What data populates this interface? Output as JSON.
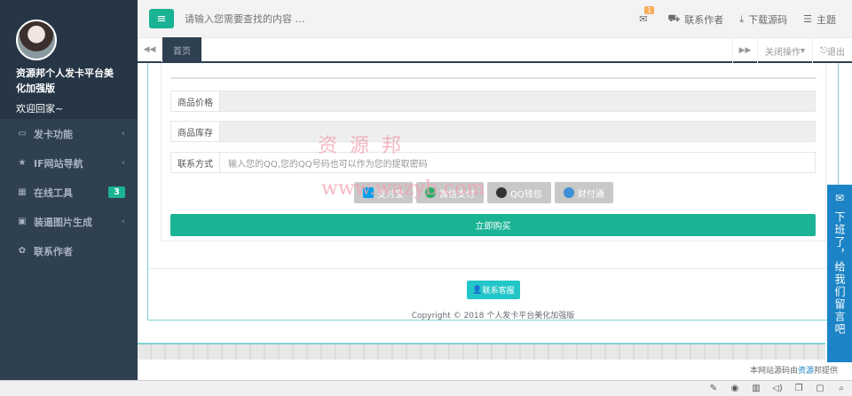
{
  "sidebar": {
    "user_name": "资源邦个人发卡平台美化加强版",
    "welcome": "欢迎回家~",
    "items": [
      {
        "label": "发卡功能",
        "icon": "monitor-icon"
      },
      {
        "label": "IF网站导航",
        "icon": "star-icon"
      },
      {
        "label": "在线工具",
        "icon": "grid-icon",
        "badge": "3"
      },
      {
        "label": "装逼图片生成",
        "icon": "image-icon"
      },
      {
        "label": "联系作者",
        "icon": "gear-icon"
      }
    ]
  },
  "topbar": {
    "search_placeholder": "请输入您需要查找的内容 …",
    "notification_count": "1",
    "contact_author": "联系作者",
    "download_source": "下载源码",
    "theme": "主题"
  },
  "tabs": {
    "home": "首页",
    "close_ops": "关闭操作",
    "logout": "退出"
  },
  "form": {
    "price_label": "商品价格",
    "stock_label": "商品库存",
    "contact_label": "联系方式",
    "contact_placeholder": "输入您的QQ,您的QQ号码也可以作为您的提取密码",
    "pay_alipay": "支付宝",
    "pay_wechat": "微信支付",
    "pay_qq": "QQ钱包",
    "pay_tenpay": "财付通",
    "buy_button": "立即购买"
  },
  "page": {
    "contact_service": "联系客服",
    "copyright": "Copyright © 2018 个人发卡平台美化加强版"
  },
  "footer": {
    "prefix": "本网站源码由",
    "link": "资源",
    "suffix": "邦提供"
  },
  "message_tab": {
    "text": "下班了，给我们留言吧"
  },
  "watermark": {
    "line1": "资源邦",
    "line2": "www.wazyb.com"
  },
  "colors": {
    "sidebar": "#2f4050",
    "primary": "#1ab394",
    "info": "#23c6c8",
    "message_tab": "#1c84c6"
  }
}
